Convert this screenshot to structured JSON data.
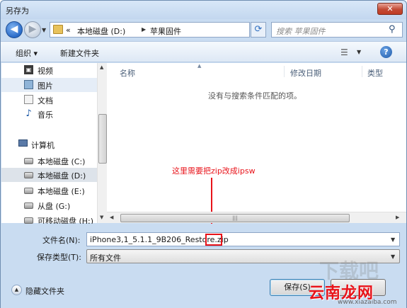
{
  "window": {
    "title": "另存为",
    "close_glyph": "✕"
  },
  "nav": {
    "back_glyph": "◀",
    "forward_glyph": "▶",
    "breadcrumb": [
      "«",
      "本地磁盘 (D:)",
      "苹果固件"
    ],
    "search_placeholder": "搜索 苹果固件"
  },
  "toolbar": {
    "organize": "组织 ▾",
    "new_folder": "新建文件夹"
  },
  "sidebar": {
    "libraries": [
      {
        "label": "视频",
        "icon": "video-library-icon"
      },
      {
        "label": "图片",
        "icon": "pictures-library-icon"
      },
      {
        "label": "文档",
        "icon": "documents-library-icon"
      },
      {
        "label": "音乐",
        "icon": "music-library-icon"
      }
    ],
    "computer": {
      "label": "计算机",
      "icon": "computer-icon"
    },
    "drives": [
      {
        "label": "本地磁盘 (C:)",
        "icon": "system-drive-icon"
      },
      {
        "label": "本地磁盘 (D:)",
        "icon": "drive-icon"
      },
      {
        "label": "本地磁盘 (E:)",
        "icon": "drive-icon"
      },
      {
        "label": "从盘 (G:)",
        "icon": "drive-icon"
      },
      {
        "label": "可移动磁盘 (H:)",
        "icon": "removable-drive-icon"
      }
    ]
  },
  "filelist": {
    "columns": [
      "名称",
      "修改日期",
      "类型"
    ],
    "empty_message": "没有与搜索条件匹配的项。"
  },
  "annotation": {
    "text": "这里需要把zip改成ipsw",
    "color": "#e8131a"
  },
  "form": {
    "filename_label": "文件名(N):",
    "filename_value": "iPhone3,1_5.1.1_9B206_Restore.zip",
    "filetype_label": "保存类型(T):",
    "filetype_value": "所有文件",
    "hide_folders": "隐藏文件夹",
    "save_label": "保存(S)"
  },
  "watermark": {
    "text": "云南龙网",
    "url": "www.xiazaiba.com",
    "bg_text": "下载吧"
  }
}
